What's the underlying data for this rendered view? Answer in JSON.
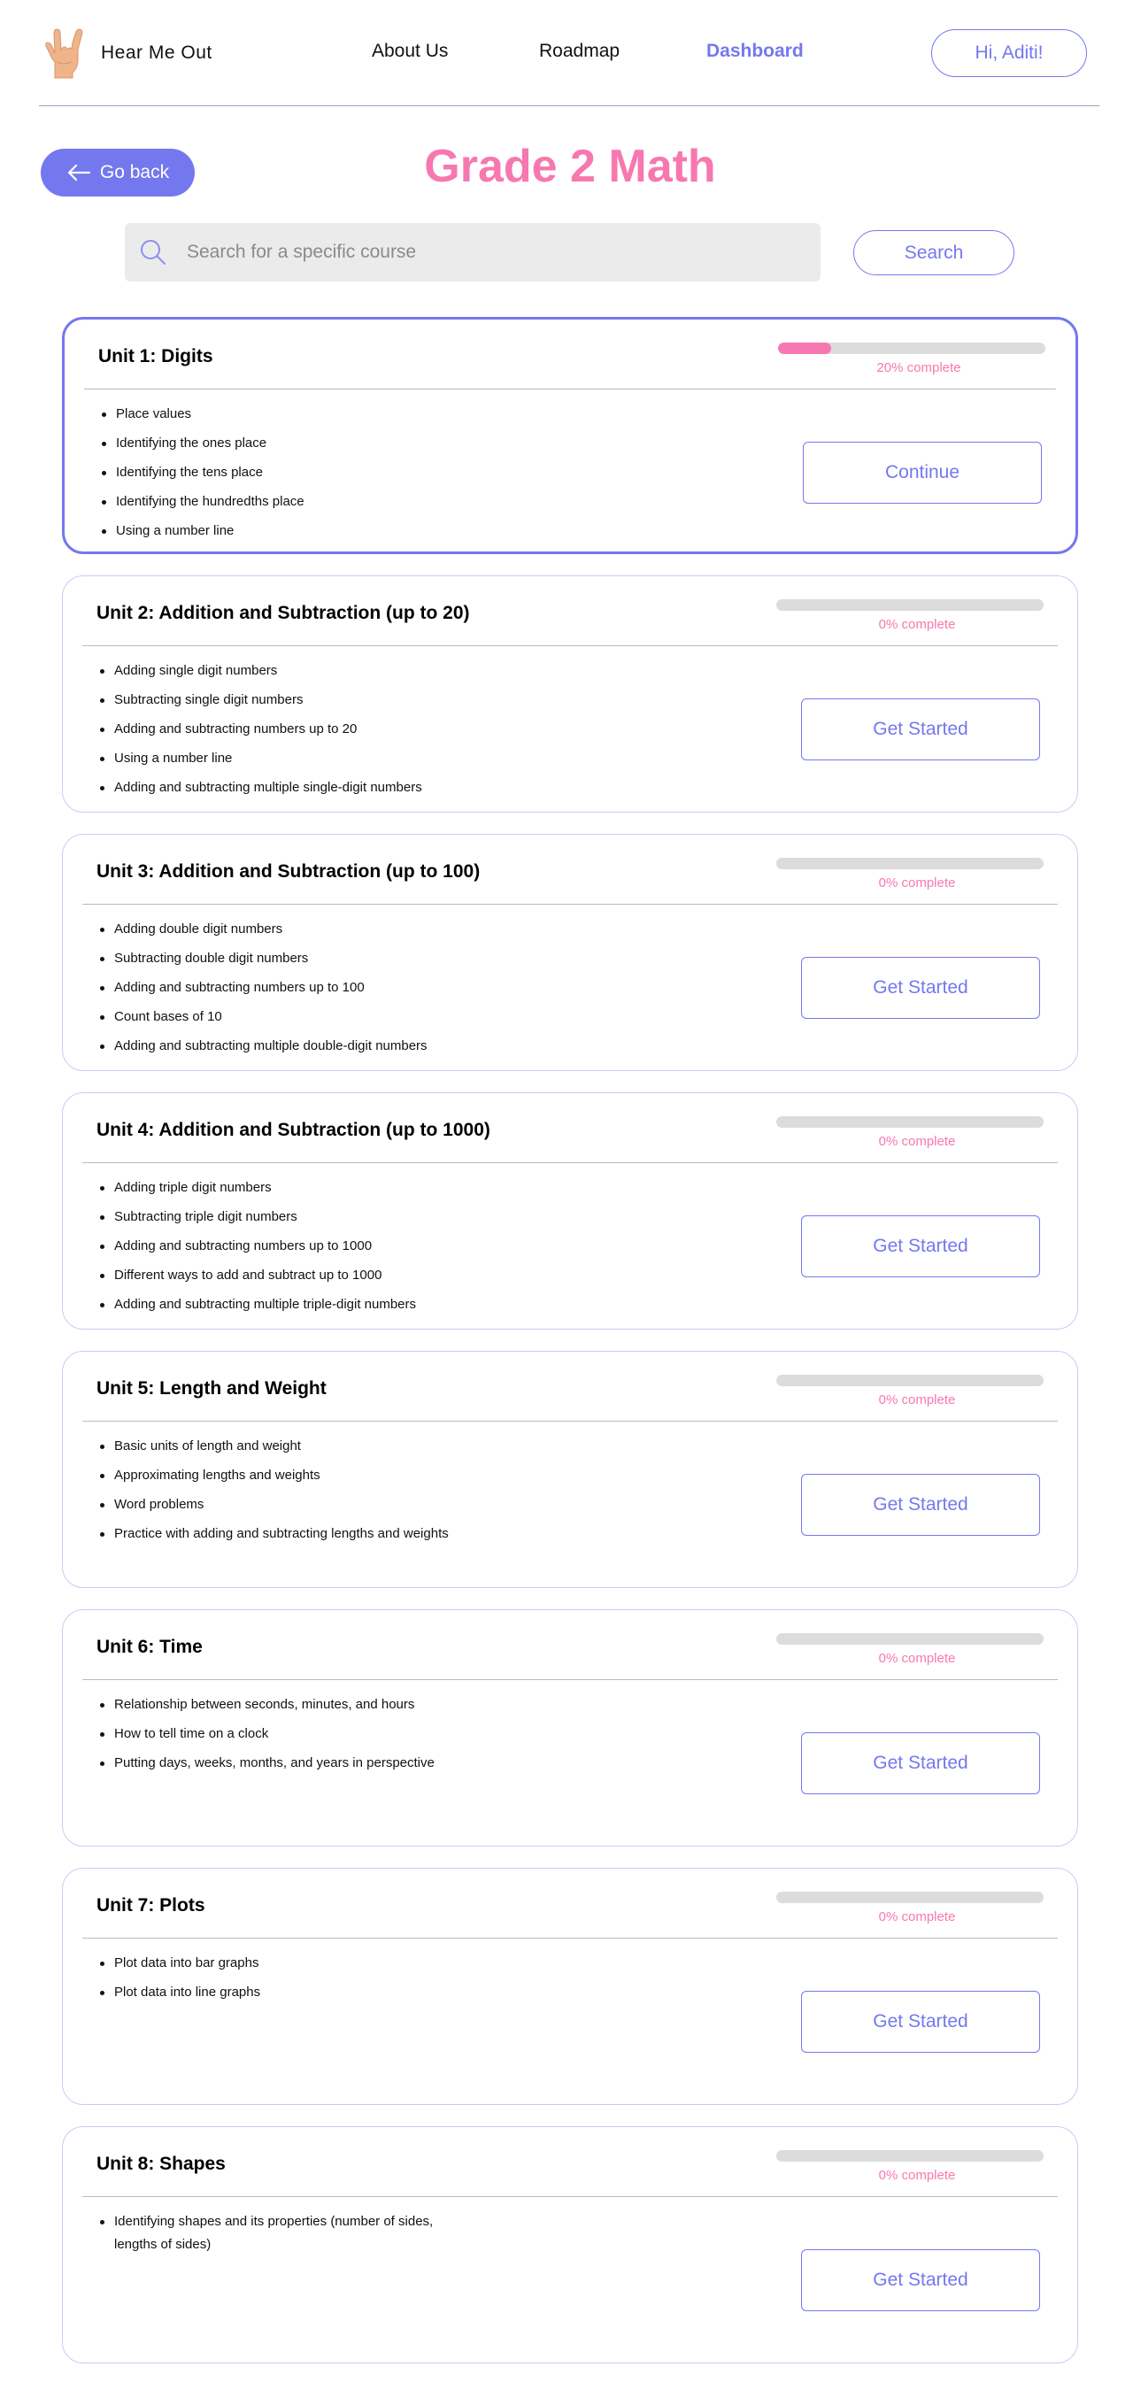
{
  "header": {
    "brand": "Hear Me Out",
    "nav": [
      {
        "label": "About Us",
        "active": false
      },
      {
        "label": "Roadmap",
        "active": false
      },
      {
        "label": "Dashboard",
        "active": true
      }
    ],
    "greeting": "Hi, Aditi!"
  },
  "page": {
    "back_label": "Go back",
    "title": "Grade 2 Math"
  },
  "search": {
    "placeholder": "Search for a specific course",
    "value": "",
    "button_label": "Search"
  },
  "colors": {
    "accent": "#7478ee",
    "brand_pink": "#f778b0",
    "track": "#dcdcdc",
    "search_bg": "#ebebeb"
  },
  "units": [
    {
      "title": "Unit 1: Digits",
      "progress": 20,
      "progress_text": "20% complete",
      "topics": [
        "Place values",
        "Identifying the ones place",
        "Identifying the tens place",
        "Identifying the hundredths place",
        "Using a number line"
      ],
      "button_label": "Continue",
      "current": true
    },
    {
      "title": "Unit 2: Addition and Subtraction (up to 20)",
      "progress": 0,
      "progress_text": "0% complete",
      "topics": [
        "Adding single digit numbers",
        "Subtracting single digit numbers",
        "Adding and subtracting numbers up to 20",
        "Using a number line",
        "Adding and subtracting multiple single-digit numbers"
      ],
      "button_label": "Get Started",
      "current": false
    },
    {
      "title": "Unit 3: Addition and Subtraction (up to 100)",
      "progress": 0,
      "progress_text": "0% complete",
      "topics": [
        "Adding double digit numbers",
        "Subtracting double digit numbers",
        "Adding and subtracting numbers up to 100",
        "Count bases of 10",
        "Adding and subtracting multiple double-digit numbers"
      ],
      "button_label": "Get Started",
      "current": false
    },
    {
      "title": "Unit 4: Addition and Subtraction (up to 1000)",
      "progress": 0,
      "progress_text": "0% complete",
      "topics": [
        "Adding triple digit numbers",
        "Subtracting triple digit numbers",
        "Adding and subtracting numbers up to 1000",
        "Different ways to add and subtract up to 1000",
        "Adding and subtracting multiple triple-digit numbers"
      ],
      "button_label": "Get Started",
      "current": false
    },
    {
      "title": "Unit 5: Length and Weight",
      "progress": 0,
      "progress_text": "0% complete",
      "topics": [
        "Basic units of length and weight",
        "Approximating lengths and weights",
        "Word problems",
        "Practice with adding and subtracting lengths and weights"
      ],
      "button_label": "Get Started",
      "current": false
    },
    {
      "title": "Unit 6: Time",
      "progress": 0,
      "progress_text": "0% complete",
      "topics": [
        "Relationship between seconds, minutes, and hours",
        "How to tell time on a clock",
        "Putting days, weeks, months, and years in perspective"
      ],
      "button_label": "Get Started",
      "current": false
    },
    {
      "title": "Unit 7: Plots",
      "progress": 0,
      "progress_text": "0% complete",
      "topics": [
        "Plot data into bar graphs",
        "Plot data into line graphs"
      ],
      "button_label": "Get Started",
      "current": false
    },
    {
      "title": "Unit 8: Shapes",
      "progress": 0,
      "progress_text": "0% complete",
      "topics": [
        "Identifying shapes and its properties (number of sides, lengths of sides)"
      ],
      "button_label": "Get Started",
      "current": false
    }
  ]
}
